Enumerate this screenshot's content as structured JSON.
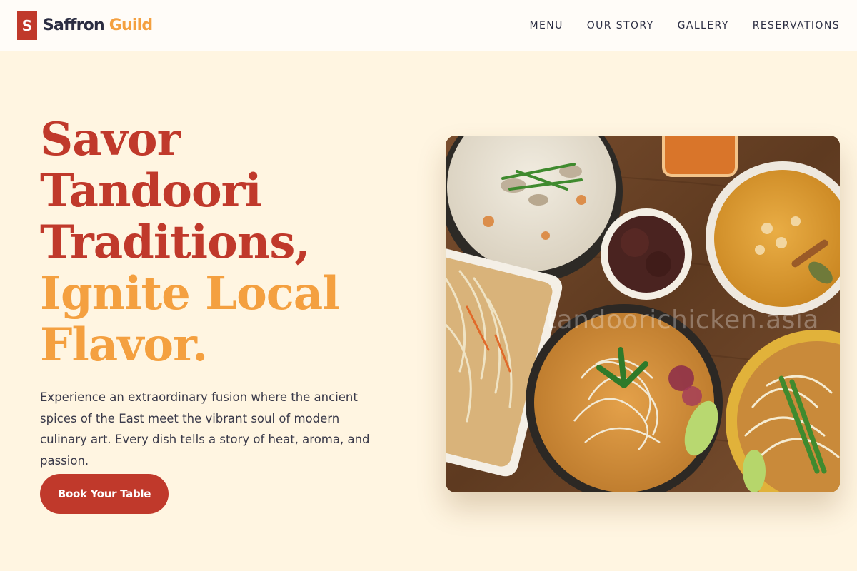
{
  "brand": {
    "mark": "S",
    "name_first": "Saffron",
    "name_second": "Guild"
  },
  "nav": {
    "items": [
      "MENU",
      "OUR STORY",
      "GALLERY",
      "RESERVATIONS"
    ]
  },
  "hero": {
    "headline_lines": [
      "Savor",
      "Tandoori",
      "Traditions,",
      "Ignite Local",
      "Flavor."
    ],
    "description": "Experience an extraordinary fusion where the ancient spices of the East meet the vibrant soul of modern culinary art. Every dish tells a story of heat, aroma, and passion.",
    "cta_label": "Book Your Table",
    "image_watermark": "tandoorichicken.asia"
  },
  "colors": {
    "brand_red": "#c0392b",
    "brand_orange": "#f4a040",
    "page_background": "#fff5e1",
    "text_dark": "#2b2d42"
  }
}
